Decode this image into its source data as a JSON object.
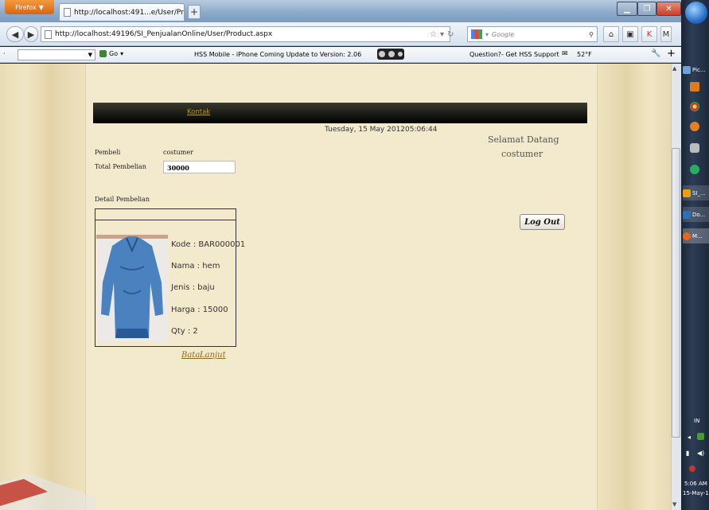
{
  "browser": {
    "menu_label": "Firefox",
    "tab_title": "http://localhost:491...e/User/Product.aspx",
    "new_tab": "+",
    "url": "http://localhost:49196/SI_PenjualanOnline/User/Product.aspx",
    "search_placeholder": "Google"
  },
  "toolbar": {
    "go_label": "Go",
    "hss_text": "HSS Mobile - iPhone Coming   Update to Version: 2.06",
    "question_text": "Question?- Get HSS Support",
    "weather": "52°F"
  },
  "page": {
    "nav_link": "Kontak",
    "datetime": "Tuesday, 15 May 201205:06:44",
    "welcome_title": "Selamat Datang",
    "welcome_user": "costumer",
    "pembeli_label": "Pembeli",
    "pembeli_value": "costumer",
    "total_label": "Total Pembelian",
    "total_value": "30000",
    "detail_label": "Detail Pembelian",
    "product": {
      "kode": "Kode   : BAR000001",
      "nama": "Nama : hem",
      "jenis": "Jenis   : baju",
      "harga": "Harga : 15000",
      "qty": "Qty    : 2"
    },
    "batal": "Batal",
    "lanjut": "Lanjut",
    "logout": "Log Out"
  },
  "taskbar": {
    "items": [
      "Pic...",
      "SI_...",
      "Do...",
      "M..."
    ],
    "lang": "IN",
    "time": "5:06 AM",
    "date": "15-May-1"
  }
}
